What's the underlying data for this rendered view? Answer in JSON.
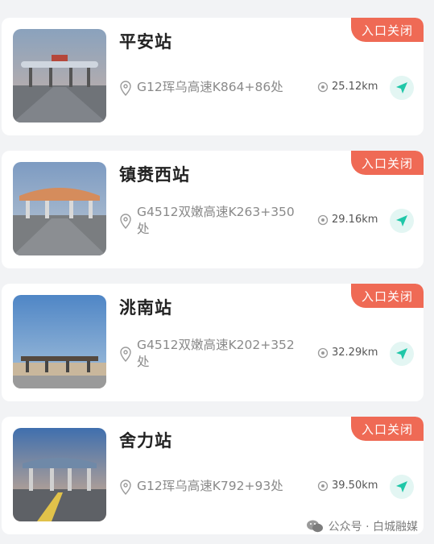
{
  "stations": [
    {
      "name": "平安站",
      "status": "入口关闭",
      "address": "G12珲乌高速K864+86处",
      "distance": "25.12km",
      "photo": "toll-plaza-photo"
    },
    {
      "name": "镇赉西站",
      "status": "入口关闭",
      "address": "G4512双嫩高速K263+350处",
      "distance": "29.16km",
      "photo": "toll-plaza-photo"
    },
    {
      "name": "洮南站",
      "status": "入口关闭",
      "address": "G4512双嫩高速K202+352处",
      "distance": "32.29km",
      "photo": "toll-plaza-photo"
    },
    {
      "name": "舍力站",
      "status": "入口关闭",
      "address": "G12珲乌高速K792+93处",
      "distance": "39.50km",
      "photo": "toll-plaza-photo"
    }
  ],
  "watermark": {
    "text": "公众号 · 白城融媒",
    "icon": "wechat-icon"
  },
  "colors": {
    "badge": "#ef6a55",
    "nav_bg": "#e3f6f3",
    "nav_icon": "#1fc7a8"
  }
}
